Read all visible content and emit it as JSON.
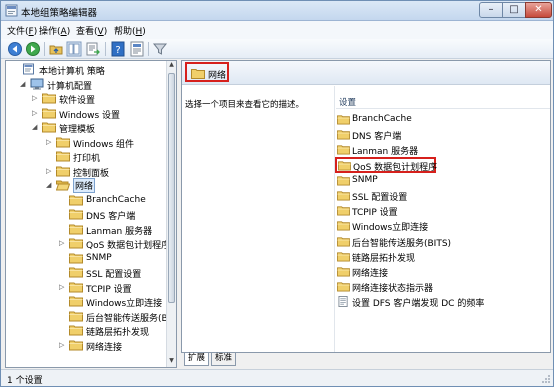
{
  "window": {
    "title": "本地组策略编辑器",
    "controls": {
      "minimize": "–",
      "maximize": "□",
      "close": "✕"
    }
  },
  "menu": [
    {
      "label": "文件(F)",
      "text": "文件(",
      "key": "F",
      "end": ")"
    },
    {
      "label": "操作(A)",
      "text": "操作(",
      "key": "A",
      "end": ")"
    },
    {
      "label": "查看(V)",
      "text": "查看(",
      "key": "V",
      "end": ")"
    },
    {
      "label": "帮助(H)",
      "text": "帮助(",
      "key": "H",
      "end": ")"
    }
  ],
  "toolbar": {
    "buttons": [
      "back-icon",
      "forward-icon",
      "up-folder-icon",
      "show-tree-icon",
      "export-list-icon",
      "help-icon",
      "properties-icon",
      "filter-icon"
    ]
  },
  "tree": [
    {
      "label": "本地计算机 策略",
      "level": 0,
      "arrow": "",
      "icon": "policy-icon"
    },
    {
      "label": "计算机配置",
      "level": 1,
      "arrow": "◢",
      "icon": "computer-icon"
    },
    {
      "label": "软件设置",
      "level": 2,
      "arrow": "▷",
      "icon": "folder-icon"
    },
    {
      "label": "Windows 设置",
      "level": 2,
      "arrow": "▷",
      "icon": "folder-icon"
    },
    {
      "label": "管理模板",
      "level": 2,
      "arrow": "◢",
      "icon": "folder-icon"
    },
    {
      "label": "Windows 组件",
      "level": 3,
      "arrow": "▷",
      "icon": "folder-icon"
    },
    {
      "label": "打印机",
      "level": 3,
      "arrow": "",
      "icon": "folder-icon"
    },
    {
      "label": "控制面板",
      "level": 3,
      "arrow": "▷",
      "icon": "folder-icon"
    },
    {
      "label": "网络",
      "level": 3,
      "arrow": "◢",
      "icon": "folder-open-icon",
      "selected": true
    },
    {
      "label": "BranchCache",
      "level": 4,
      "arrow": "",
      "icon": "folder-icon"
    },
    {
      "label": "DNS 客户端",
      "level": 4,
      "arrow": "",
      "icon": "folder-icon"
    },
    {
      "label": "Lanman 服务器",
      "level": 4,
      "arrow": "",
      "icon": "folder-icon"
    },
    {
      "label": "QoS 数据包计划程序",
      "level": 4,
      "arrow": "▷",
      "icon": "folder-icon"
    },
    {
      "label": "SNMP",
      "level": 4,
      "arrow": "",
      "icon": "folder-icon"
    },
    {
      "label": "SSL 配置设置",
      "level": 4,
      "arrow": "",
      "icon": "folder-icon"
    },
    {
      "label": "TCPIP 设置",
      "level": 4,
      "arrow": "▷",
      "icon": "folder-icon"
    },
    {
      "label": "Windows立即连接",
      "level": 4,
      "arrow": "",
      "icon": "folder-icon"
    },
    {
      "label": "后台智能传送服务(BIT",
      "level": 4,
      "arrow": "",
      "icon": "folder-icon"
    },
    {
      "label": "链路层拓扑发现",
      "level": 4,
      "arrow": "",
      "icon": "folder-icon"
    },
    {
      "label": "网络连接",
      "level": 4,
      "arrow": "▷",
      "icon": "folder-icon"
    }
  ],
  "right": {
    "header_label": "网络",
    "description": "选择一个项目来查看它的描述。",
    "column_header": "设置",
    "items": [
      {
        "label": "BranchCache",
        "icon": "folder-icon"
      },
      {
        "label": "DNS 客户端",
        "icon": "folder-icon"
      },
      {
        "label": "Lanman 服务器",
        "icon": "folder-icon"
      },
      {
        "label": "QoS 数据包计划程序",
        "icon": "folder-icon",
        "highlighted": true
      },
      {
        "label": "SNMP",
        "icon": "folder-icon"
      },
      {
        "label": "SSL 配置设置",
        "icon": "folder-icon"
      },
      {
        "label": "TCPIP 设置",
        "icon": "folder-icon"
      },
      {
        "label": "Windows立即连接",
        "icon": "folder-icon"
      },
      {
        "label": "后台智能传送服务(BITS)",
        "icon": "folder-icon"
      },
      {
        "label": "链路层拓扑发现",
        "icon": "folder-icon"
      },
      {
        "label": "网络连接",
        "icon": "folder-icon"
      },
      {
        "label": "网络连接状态指示器",
        "icon": "folder-icon"
      },
      {
        "label": "设置 DFS 客户端发现 DC 的频率",
        "icon": "setting-icon"
      }
    ]
  },
  "tabs": [
    {
      "label": "扩展",
      "active": true
    },
    {
      "label": "标准",
      "active": false
    }
  ],
  "status": {
    "text": "1 个设置"
  },
  "colors": {
    "highlight_border": "#d6201c",
    "folder": "#e8c25a",
    "selection": "#dcebfc"
  }
}
